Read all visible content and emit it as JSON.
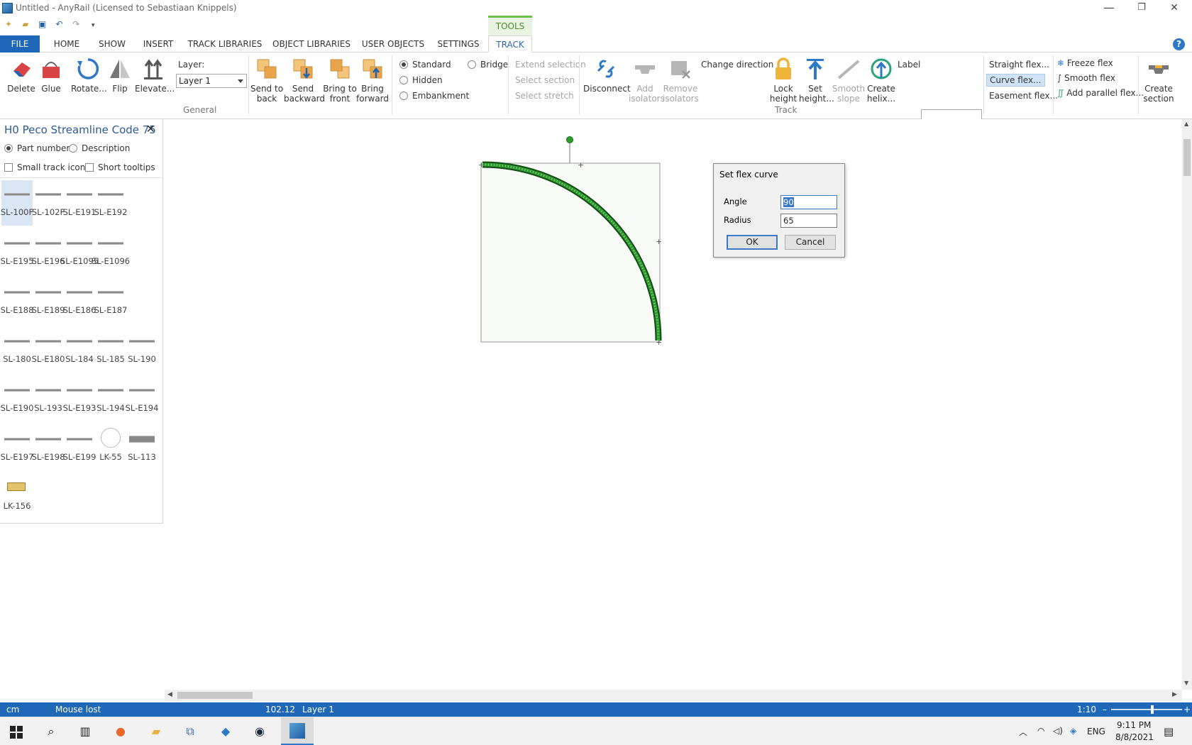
{
  "window": {
    "title": "Untitled - AnyRail (Licensed to Sebastiaan Knippels)",
    "minimize": "—",
    "restore": "❐",
    "close": "✕"
  },
  "qat": [
    "new",
    "open",
    "save",
    "undo",
    "redo",
    "customize"
  ],
  "context_tab": "TOOLS",
  "tabs": [
    "FILE",
    "HOME",
    "SHOW",
    "INSERT",
    "TRACK LIBRARIES",
    "OBJECT LIBRARIES",
    "USER OBJECTS",
    "SETTINGS",
    "TRACK"
  ],
  "help": "?",
  "ribbon": {
    "delete": "Delete",
    "glue": "Glue",
    "rotate": "Rotate...",
    "flip": "Flip",
    "elevate": "Elevate...",
    "layer_label": "Layer:",
    "layer_value": "Layer 1",
    "general_group": "General",
    "send_to_back_1": "Send to",
    "send_to_back_2": "back",
    "send_backward_1": "Send",
    "send_backward_2": "backward",
    "bring_to_front_1": "Bring to",
    "bring_to_front_2": "front",
    "bring_forward_1": "Bring",
    "bring_forward_2": "forward",
    "standard": "Standard",
    "hidden": "Hidden",
    "embankment": "Embankment",
    "bridge": "Bridge",
    "extend_selection": "Extend selection",
    "select_section": "Select section",
    "select_stretch": "Select stretch",
    "disconnect": "Disconnect",
    "add_isolators_1": "Add",
    "add_isolators_2": "isolators",
    "remove_isolators_1": "Remove",
    "remove_isolators_2": "isolators",
    "change_direction": "Change direction",
    "lock_height_1": "Lock",
    "lock_height_2": "height",
    "set_height_1": "Set",
    "set_height_2": "height...",
    "smooth_slope_1": "Smooth",
    "smooth_slope_2": "slope",
    "create_helix_1": "Create",
    "create_helix_2": "helix...",
    "track_group": "Track",
    "label": "Label",
    "straight_flex": "Straight flex...",
    "curve_flex": "Curve flex...",
    "easement_flex": "Easement flex...",
    "freeze_flex": "Freeze flex",
    "smooth_flex": "Smooth flex",
    "add_parallel_flex": "Add parallel flex...",
    "create_section_1": "Create",
    "create_section_2": "section"
  },
  "panel": {
    "title": "H0 Peco Streamline Code 75",
    "close": "✕",
    "part_number": "Part number",
    "description": "Description",
    "small_icons": "Small track icons",
    "short_tooltips": "Short tooltips",
    "rows": [
      [
        "SL-100F",
        "SL-102F",
        "SL-E191",
        "SL-E192"
      ],
      [
        "SL-E195",
        "SL-E196",
        "SL-E1095",
        "SL-E1096"
      ],
      [
        "SL-E188",
        "SL-E189",
        "SL-E186",
        "SL-E187"
      ],
      [
        "SL-180",
        "SL-E180",
        "SL-184",
        "SL-185",
        "SL-190"
      ],
      [
        "SL-E190",
        "SL-193",
        "SL-E193",
        "SL-194",
        "SL-E194"
      ],
      [
        "SL-E197",
        "SL-E198",
        "SL-E199",
        "LK-55",
        "SL-113"
      ],
      [
        "LK-156"
      ]
    ]
  },
  "dialog": {
    "title": "Set flex curve",
    "angle_label": "Angle",
    "angle_value": "90",
    "radius_label": "Radius",
    "radius_value": "65",
    "ok": "OK",
    "cancel": "Cancel"
  },
  "status": {
    "unit": "cm",
    "mouse": "Mouse lost",
    "coord": "102.12",
    "layer": "Layer 1",
    "scale": "1:10",
    "zoom_minus": "–",
    "zoom_plus": "+"
  },
  "taskbar": {
    "lang": "ENG",
    "time": "9:11 PM",
    "date": "8/8/2021"
  },
  "colors": {
    "accent": "#1f68b8",
    "track": "#1e7a1e",
    "tools_tab": "#6dbf4b"
  }
}
